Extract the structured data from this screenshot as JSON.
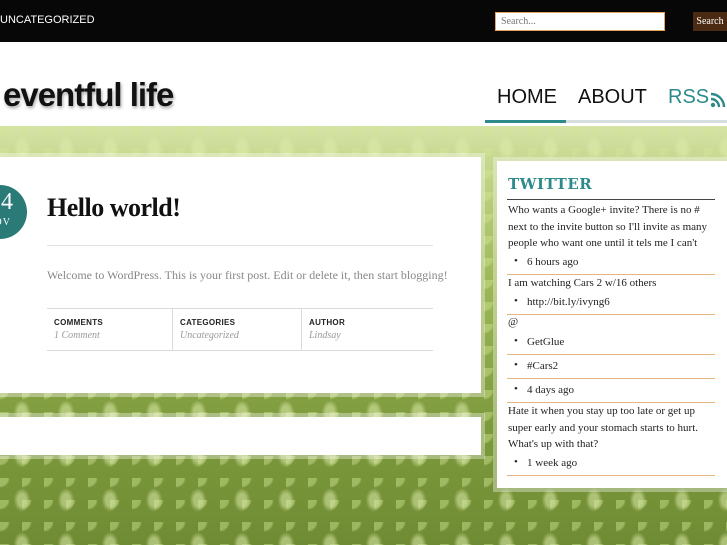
{
  "topbar": {
    "category": "UNCATEGORIZED",
    "search_placeholder": "Search...",
    "search_button": "Search"
  },
  "site": {
    "title": "eventful life"
  },
  "nav": {
    "home": "HOME",
    "about": "ABOUT",
    "rss": "RSS",
    "rss_icon": "rss-icon"
  },
  "colors": {
    "accent": "#2e8a8a",
    "search_border": "#e8a45a",
    "search_button": "#4a2a12",
    "tweet_rule": "#e5b583"
  },
  "post": {
    "date_day": "4",
    "date_month": "OV",
    "title": "Hello world!",
    "body": "Welcome to WordPress. This is your first post. Edit or delete it, then start blogging!",
    "meta": [
      {
        "label": "COMMENTS",
        "value": "1 Comment"
      },
      {
        "label": "CATEGORIES",
        "value": "Uncategorized"
      },
      {
        "label": "AUTHOR",
        "value": "Lindsay"
      }
    ]
  },
  "sidebar": {
    "title": "TWITTER",
    "tweet1": "Who wants a Google+ invite? There is no # next to the invite button so I'll invite as many people who want one until it tels me I can't",
    "tweet1_time": "6 hours ago",
    "tweet2": "I am watching Cars 2 w/16 others",
    "tweet2_link": "http://bit.ly/ivyng6",
    "tweet2_at": "@",
    "tweet2_user": "GetGlue",
    "tweet2_tag": "#Cars2",
    "tweet2_time": "4 days ago",
    "tweet3": "Hate it when you stay up too late or get up super early and your stomach starts to hurt. What's up with that?",
    "tweet3_time": "1 week ago"
  }
}
